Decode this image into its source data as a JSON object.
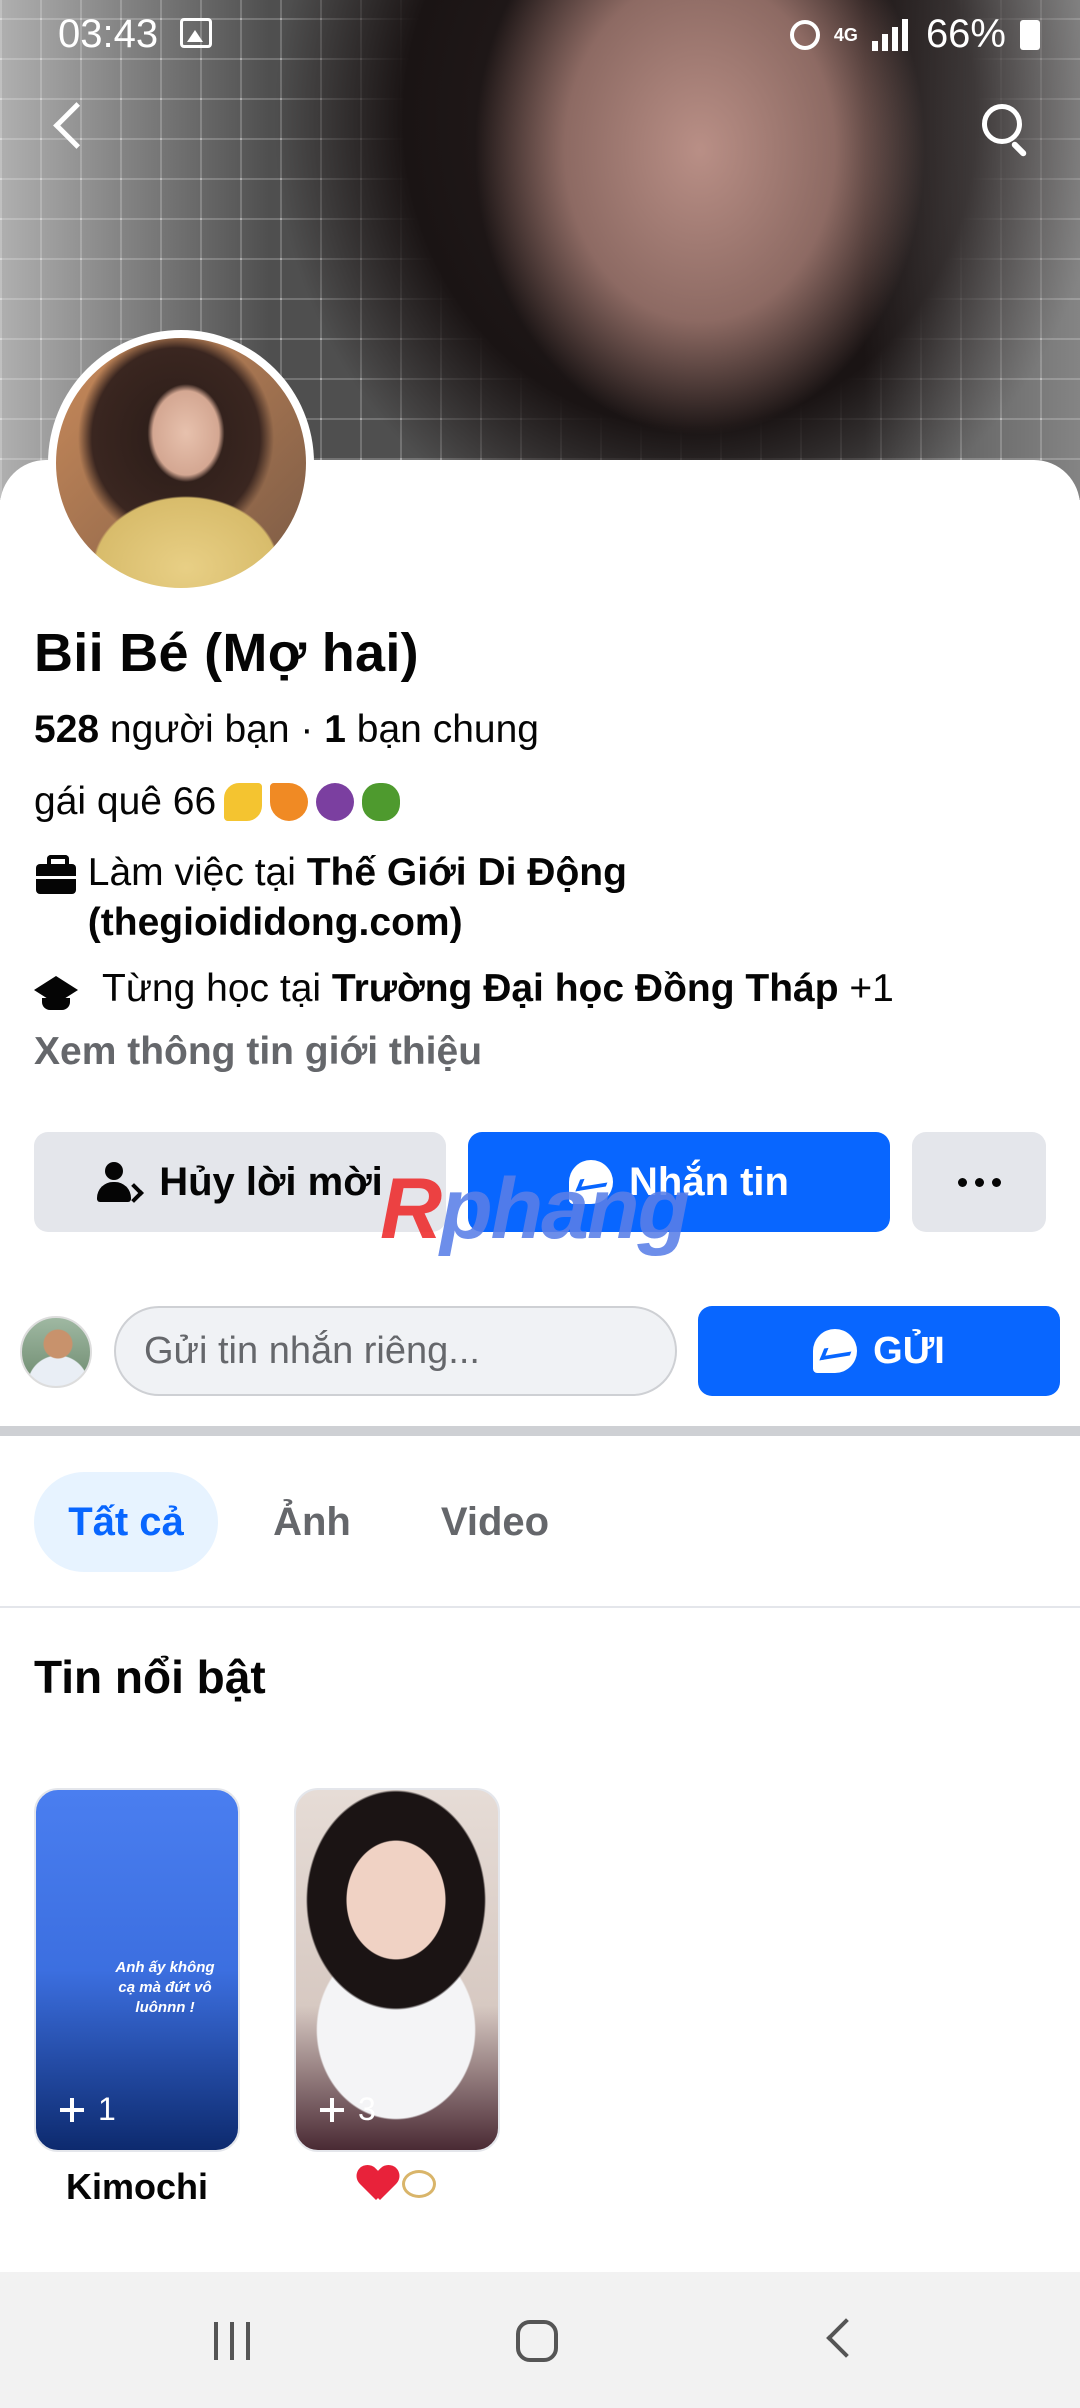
{
  "status_bar": {
    "time": "03:43",
    "network": "4G",
    "battery": "66%"
  },
  "profile": {
    "name": "Bii Bé (Mợ hai)",
    "friends_count": "528",
    "friends_label": "người bạn",
    "separator": "·",
    "mutual_count": "1",
    "mutual_label": "bạn chung",
    "bio": "gái quê 66",
    "work_prefix": "Làm việc tại",
    "work_place": "Thế Giới Di Động (thegioididong.com)",
    "study_prefix": "Từng học tại",
    "study_place": "Trường Đại học Đồng Tháp",
    "study_extra": "+1",
    "see_intro": "Xem thông tin giới thiệu"
  },
  "actions": {
    "cancel_request": "Hủy lời mời",
    "message": "Nhắn tin",
    "more": "..."
  },
  "watermark": {
    "r": "R",
    "rest": "phang"
  },
  "private_message": {
    "placeholder": "Gửi tin nhắn riêng...",
    "send": "GỬI"
  },
  "tabs": [
    {
      "label": "Tất cả",
      "active": true
    },
    {
      "label": "Ảnh",
      "active": false
    },
    {
      "label": "Video",
      "active": false
    }
  ],
  "highlights": {
    "title": "Tin nổi bật",
    "items": [
      {
        "label": "Kimochi",
        "count": "1",
        "overlay_text": "Anh ấy không cạ mà đứt vô luônnn !"
      },
      {
        "label": "",
        "count": "3",
        "overlay_text": ""
      }
    ]
  },
  "colors": {
    "accent": "#0866ff",
    "secondary_button": "#e4e6eb",
    "muted_text": "#65676b",
    "active_tab_bg": "#e7f3ff"
  }
}
